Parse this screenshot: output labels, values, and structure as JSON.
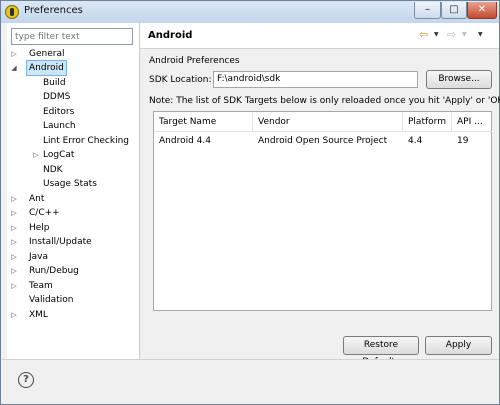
{
  "window": {
    "title": "Preferences",
    "controls": {
      "minimize": "–",
      "maximize": "□",
      "close": "✕"
    }
  },
  "sidebar": {
    "filter_placeholder": "type filter text",
    "items": [
      {
        "label": "General",
        "expandable": true,
        "expanded": false
      },
      {
        "label": "Android",
        "expandable": true,
        "expanded": true,
        "selected": true
      },
      {
        "label": "Build"
      },
      {
        "label": "DDMS"
      },
      {
        "label": "Editors"
      },
      {
        "label": "Launch"
      },
      {
        "label": "Lint Error Checking"
      },
      {
        "label": "LogCat",
        "expandable": true,
        "expanded": false
      },
      {
        "label": "NDK"
      },
      {
        "label": "Usage Stats"
      },
      {
        "label": "Ant",
        "expandable": true
      },
      {
        "label": "C/C++",
        "expandable": true
      },
      {
        "label": "Help",
        "expandable": true
      },
      {
        "label": "Install/Update",
        "expandable": true
      },
      {
        "label": "Java",
        "expandable": true
      },
      {
        "label": "Run/Debug",
        "expandable": true
      },
      {
        "label": "Team",
        "expandable": true
      },
      {
        "label": "Validation"
      },
      {
        "label": "XML",
        "expandable": true
      }
    ]
  },
  "main": {
    "title": "Android",
    "subtitle": "Android Preferences",
    "sdk_location_label": "SDK Location:",
    "sdk_location_value": "F:\\android\\sdk",
    "browse_label": "Browse...",
    "note": "Note: The list of SDK Targets below is only reloaded once you hit 'Apply' or 'OK'.",
    "table": {
      "columns": [
        "Target Name",
        "Vendor",
        "Platform",
        "API ..."
      ],
      "rows": [
        [
          "Android 4.4",
          "Android Open Source Project",
          "4.4",
          "19"
        ]
      ]
    },
    "restore_defaults_label": "Restore Defaults",
    "apply_label": "Apply"
  },
  "footer": {
    "help_symbol": "?"
  },
  "icons": {
    "app": "eclipse-icon",
    "back": "back-arrow-icon",
    "forward": "forward-arrow-icon",
    "menu": "view-menu-icon",
    "help": "help-icon"
  }
}
